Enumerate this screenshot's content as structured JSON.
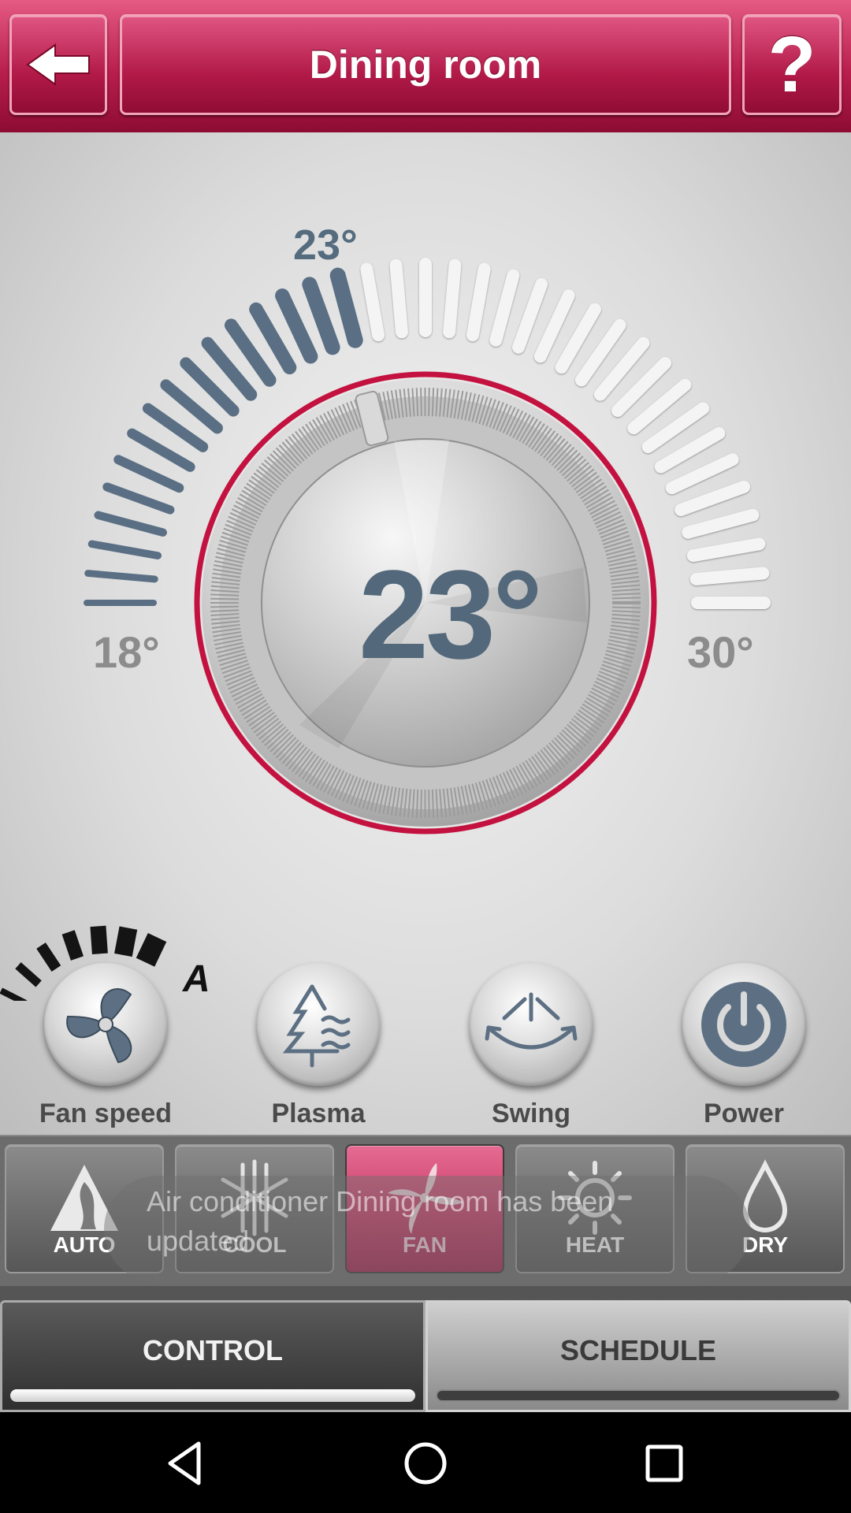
{
  "header": {
    "title": "Dining room",
    "back_icon": "back-arrow-icon",
    "help_label": "?"
  },
  "thermostat": {
    "set_temp_label": "23°",
    "current_temp": "23°",
    "min_label": "18°",
    "max_label": "30°",
    "min": 18,
    "max": 30,
    "value": 23,
    "accent_color": "#c3123f",
    "active_tick_color": "#5a6f84"
  },
  "controls": [
    {
      "label": "Fan speed",
      "icon": "fan-icon"
    },
    {
      "label": "Plasma",
      "icon": "tree-waves-icon"
    },
    {
      "label": "Swing",
      "icon": "swing-icon"
    },
    {
      "label": "Power",
      "icon": "power-icon"
    }
  ],
  "fan_speed_indicator": {
    "label": "A"
  },
  "modes": [
    {
      "label": "AUTO",
      "icon": "auto-icon",
      "active": false
    },
    {
      "label": "COOL",
      "icon": "snowflake-icon",
      "active": false
    },
    {
      "label": "FAN",
      "icon": "fan-blade-icon",
      "active": true
    },
    {
      "label": "HEAT",
      "icon": "sun-icon",
      "active": false
    },
    {
      "label": "DRY",
      "icon": "droplet-icon",
      "active": false
    }
  ],
  "toast": {
    "text": "Air conditioner Dining room has been updated"
  },
  "tabs": [
    {
      "label": "CONTROL",
      "active": true
    },
    {
      "label": "SCHEDULE",
      "active": false
    }
  ],
  "colors": {
    "brand": "#c3123f",
    "active_mode": "#c93d69"
  }
}
